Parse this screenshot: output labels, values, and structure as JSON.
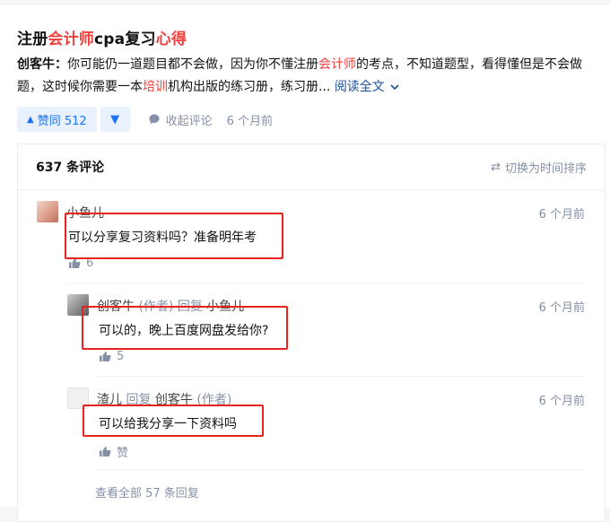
{
  "answer": {
    "title_parts": [
      {
        "text": "注册",
        "hl": false
      },
      {
        "text": "会计师",
        "hl": true
      },
      {
        "text": "cpa复习",
        "hl": false
      },
      {
        "text": "心得",
        "hl": true
      }
    ],
    "author": "创客牛",
    "excerpt_parts": [
      {
        "text": "你可能仍一道题目都不会做，因为你不懂注册",
        "hl": false
      },
      {
        "text": "会计师",
        "hl": true
      },
      {
        "text": "的考点，不知道题型，看得懂但是不会做题，这时候你需要一本",
        "hl": false
      },
      {
        "text": "培训",
        "hl": true
      },
      {
        "text": "机构出版的练习册，练习册... ",
        "hl": false
      }
    ],
    "read_more": "阅读全文",
    "vote_label": "赞同 512",
    "collapse_comments": "收起评论",
    "time": "6 个月前"
  },
  "comments": {
    "count_label": "637 条评论",
    "sort_label": "切换为时间排序",
    "items": [
      {
        "name": "小鱼儿",
        "time": "6 个月前",
        "text": "可以分享复习资料吗？准备明年考",
        "likes": "6"
      },
      {
        "name": "创客牛",
        "role": "(作者)",
        "reply": "回复",
        "reply_to": "小鱼儿",
        "time": "6 个月前",
        "text": "可以的，晚上百度网盘发给你?",
        "likes": "5"
      },
      {
        "name": "渣儿",
        "reply": "回复",
        "reply_to": "创客牛",
        "reply_to_role": "(作者)",
        "time": "6 个月前",
        "text": "可以给我分享一下资料吗",
        "likes": "赞"
      }
    ],
    "view_all": "查看全部 57 条回复"
  },
  "colors": {
    "highlight": "#f1403c",
    "accent": "#1772f6",
    "annotation_box": "#e8231f"
  }
}
